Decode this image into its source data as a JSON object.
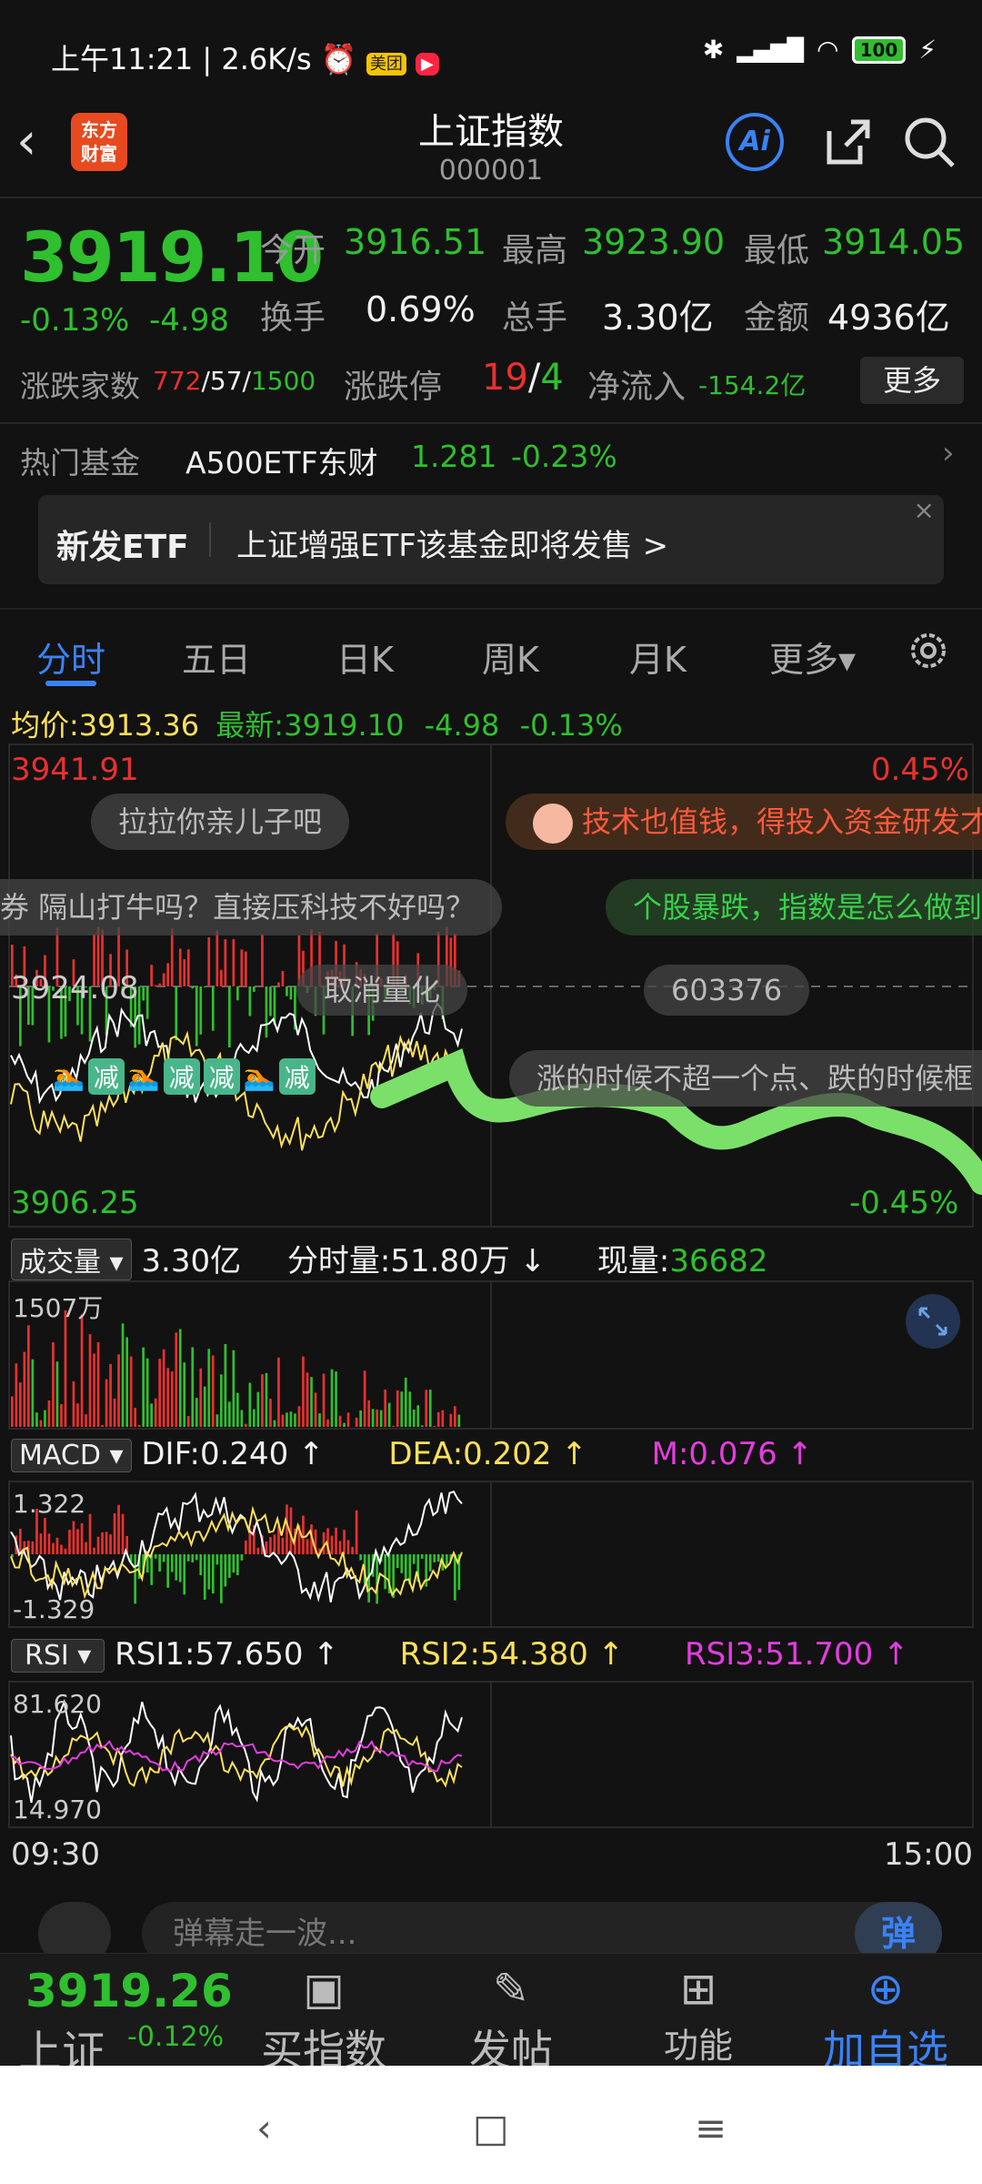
{
  "status_bar": {
    "left": "上午11:21 | 2.6K/s",
    "app_badge_1": "美团",
    "battery": "100"
  },
  "header": {
    "back": "‹",
    "logo_line1": "东方",
    "logo_line2": "财富",
    "title": "上证指数",
    "code": "000001",
    "ai_label": "Ai"
  },
  "quote": {
    "price": "3919.10",
    "change_pct": "-0.13%",
    "change_abs": "-4.98",
    "open_label": "今开",
    "open": "3916.51",
    "high_label": "最高",
    "high": "3923.90",
    "low_label": "最低",
    "low": "3914.05",
    "turnover_label": "换手",
    "turnover": "0.69%",
    "volume_label": "总手",
    "volume": "3.30亿",
    "amount_label": "金额",
    "amount": "4936亿",
    "breadth_label": "涨跌家数",
    "breadth_up": "772",
    "breadth_flat": "57",
    "breadth_down": "1500",
    "limit_label": "涨跌停",
    "limit_up": "19",
    "limit_down": "4",
    "netflow_label": "净流入",
    "netflow": "-154.2亿",
    "more": "更多"
  },
  "fund": {
    "label": "热门基金",
    "name": "A500ETF东财",
    "price": "1.281",
    "change": "-0.23%"
  },
  "etf_banner": {
    "tag": "新发ETF",
    "text": "上证增强ETF该基金即将发售  >",
    "close": "×"
  },
  "tabs": [
    "分时",
    "五日",
    "日K",
    "周K",
    "月K",
    "更多▾"
  ],
  "intraday": {
    "avg_label": "均价:",
    "avg": "3913.36",
    "latest_label": "最新:",
    "latest": "3919.10",
    "chg_abs": "-4.98",
    "chg_pct": "-0.13%",
    "y_high": "3941.91",
    "y_mid": "3924.08",
    "y_low": "3906.25",
    "pct_high": "0.45%",
    "pct_low": "-0.45%"
  },
  "danmaku": [
    "拉拉你亲儿子吧",
    "技术也值钱，得投入资金研发才",
    "券 隔山打牛吗？直接压科技不好吗？",
    "个股暴跌，指数是怎么做到",
    "取消量化",
    "603376",
    "涨的时候不超一个点、跌的时候框"
  ],
  "stickers": [
    "减",
    "减",
    "减",
    "减"
  ],
  "volume": {
    "tag": "成交量",
    "total": "3.30亿",
    "period_label": "分时量:",
    "period": "51.80万",
    "period_arrow": "↓",
    "current_label": "现量:",
    "current": "36682",
    "axis_max": "1507万"
  },
  "macd": {
    "tag": "MACD",
    "dif": "DIF:0.240",
    "dea": "DEA:0.202",
    "m": "M:0.076",
    "axis_max": "1.322",
    "axis_min": "-1.329"
  },
  "rsi": {
    "tag": "RSI",
    "rsi1": "RSI1:57.650",
    "rsi2": "RSI2:54.380",
    "rsi3": "RSI3:51.700",
    "axis_max": "81.620",
    "axis_min": "14.970"
  },
  "time_axis": {
    "start": "09:30",
    "end": "15:00"
  },
  "comment": {
    "placeholder": "弹幕走一波...",
    "toggle": "弹"
  },
  "bottom_bar": {
    "price": "3919.26",
    "name": "上证",
    "change": "-0.12%",
    "items": [
      "买指数",
      "发帖",
      "功能",
      "加自选"
    ]
  },
  "colors": {
    "up": "#e8312f",
    "down": "#2fbf2f",
    "accent": "#3b82f6",
    "avg_line": "#ffe05a"
  }
}
